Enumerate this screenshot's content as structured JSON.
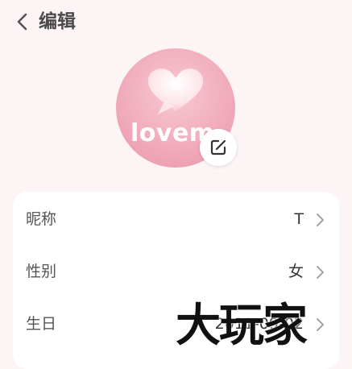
{
  "header": {
    "title": "编辑",
    "back_icon": "chevron-left-icon"
  },
  "avatar": {
    "image_text": "lovem",
    "edit_icon": "edit-square-icon",
    "bg_color": "#f1acbc"
  },
  "profile": {
    "rows": [
      {
        "label": "昵称",
        "value": "T"
      },
      {
        "label": "性别",
        "value": "女"
      },
      {
        "label": "生日",
        "value": "2011-09-02"
      }
    ]
  },
  "watermark": {
    "text": "大玩家"
  },
  "colors": {
    "page_bg": "#fdf5f5",
    "card_bg": "#ffffff",
    "title": "#4a4a4a"
  }
}
